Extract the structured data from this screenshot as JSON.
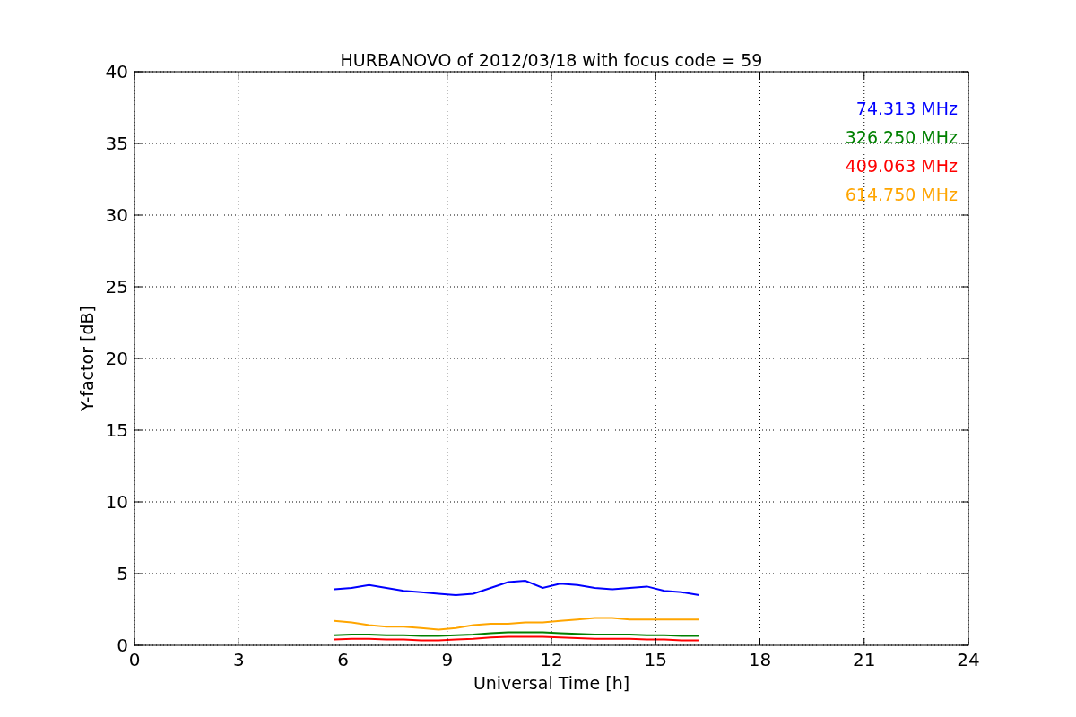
{
  "chart_data": {
    "type": "line",
    "title": "HURBANOVO of 2012/03/18 with focus code = 59",
    "xlabel": "Universal Time [h]",
    "ylabel": "Y-factor [dB]",
    "x": [
      5.75,
      6.25,
      6.75,
      7.25,
      7.75,
      8.25,
      8.75,
      9.25,
      9.75,
      10.25,
      10.75,
      11.25,
      11.75,
      12.25,
      12.75,
      13.25,
      13.75,
      14.25,
      14.75,
      15.25,
      15.75,
      16.25
    ],
    "series": [
      {
        "name": "74.313 MHz",
        "color": "#0000ff",
        "values": [
          3.9,
          4.0,
          4.2,
          4.0,
          3.8,
          3.7,
          3.6,
          3.5,
          3.6,
          4.0,
          4.4,
          4.5,
          4.0,
          4.3,
          4.2,
          4.0,
          3.9,
          4.0,
          4.1,
          3.8,
          3.7,
          3.5
        ]
      },
      {
        "name": "326.250 MHz",
        "color": "#008000",
        "values": [
          0.7,
          0.75,
          0.75,
          0.7,
          0.7,
          0.65,
          0.65,
          0.7,
          0.75,
          0.85,
          0.9,
          0.9,
          0.9,
          0.85,
          0.8,
          0.75,
          0.75,
          0.75,
          0.7,
          0.7,
          0.65,
          0.65
        ]
      },
      {
        "name": "409.063 MHz",
        "color": "#ff0000",
        "values": [
          0.4,
          0.45,
          0.45,
          0.4,
          0.4,
          0.35,
          0.35,
          0.4,
          0.45,
          0.55,
          0.6,
          0.6,
          0.6,
          0.55,
          0.5,
          0.45,
          0.45,
          0.45,
          0.4,
          0.4,
          0.35,
          0.35
        ]
      },
      {
        "name": "614.750 MHz",
        "color": "#ffa500",
        "values": [
          1.7,
          1.6,
          1.4,
          1.3,
          1.3,
          1.2,
          1.1,
          1.2,
          1.4,
          1.5,
          1.5,
          1.6,
          1.6,
          1.7,
          1.8,
          1.9,
          1.9,
          1.8,
          1.8,
          1.8,
          1.8,
          1.8
        ]
      }
    ],
    "grid": true,
    "xlim": [
      0,
      24
    ],
    "ylim": [
      0,
      40
    ],
    "xticks": [
      0,
      3,
      6,
      9,
      12,
      15,
      18,
      21,
      24
    ],
    "yticks": [
      0,
      5,
      10,
      15,
      20,
      25,
      30,
      35,
      40
    ]
  }
}
